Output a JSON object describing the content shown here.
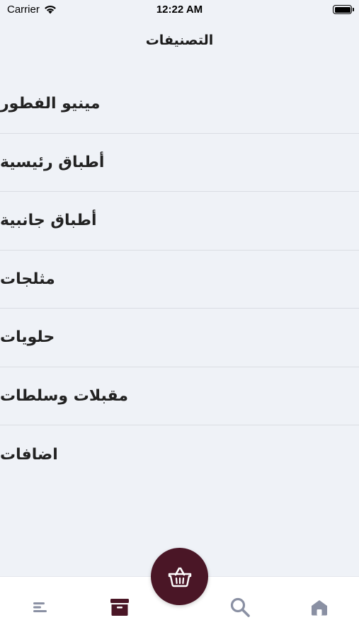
{
  "status_bar": {
    "carrier": "Carrier",
    "time": "12:22 AM"
  },
  "header": {
    "title": "التصنيفات"
  },
  "categories": [
    {
      "label": "مينيو الفطور"
    },
    {
      "label": "أطباق رئيسية"
    },
    {
      "label": "أطباق جانبية"
    },
    {
      "label": "مثلجات"
    },
    {
      "label": "حلويات"
    },
    {
      "label": "مقبلات وسلطات"
    },
    {
      "label": "اضافات"
    }
  ],
  "tab_bar": {
    "tabs": [
      {
        "icon": "menu-icon",
        "active": false
      },
      {
        "icon": "orders-box-icon",
        "active": true
      },
      {
        "icon": "search-icon",
        "active": false
      },
      {
        "icon": "home-icon",
        "active": false
      }
    ],
    "fab_icon": "basket-icon"
  },
  "colors": {
    "background": "#eff2f7",
    "accent": "#4a1626",
    "inactive_icon": "#8a90a3",
    "divider": "#dadde3"
  }
}
